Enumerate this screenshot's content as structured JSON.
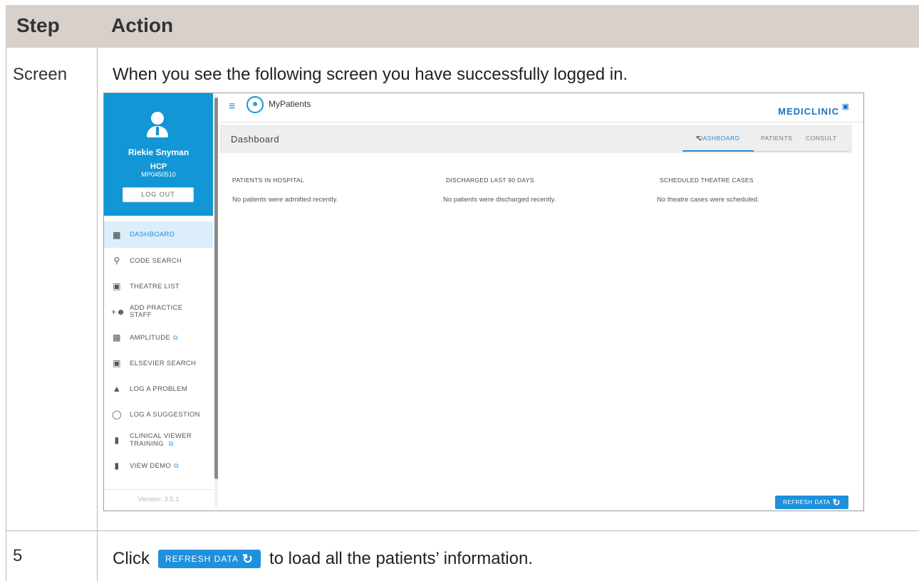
{
  "table": {
    "header_step": "Step",
    "header_action": "Action",
    "row1_step": "Screen",
    "row1_text": "When you see the following screen you have successfully logged in.",
    "row2_step": "5",
    "row2_click": "Click",
    "row2_button": "REFRESH DATA",
    "row2_rest": "to load all the patients’ information."
  },
  "app": {
    "name": "MyPatients",
    "brand": "MEDICLINIC",
    "profile": {
      "name": "Riekie Snyman",
      "role": "HCP",
      "number": "MP0450510",
      "logout": "LOG OUT"
    },
    "nav": [
      {
        "label": "DASHBOARD",
        "icon": "dashboard-icon",
        "active": true
      },
      {
        "label": "CODE SEARCH",
        "icon": "search-icon"
      },
      {
        "label": "THEATRE LIST",
        "icon": "calendar-icon"
      },
      {
        "label": "ADD PRACTICE STAFF",
        "line1": "ADD PRACTICE",
        "line2": "STAFF",
        "icon": "add-group-icon"
      },
      {
        "label": "AMPLITUDE",
        "icon": "briefcase-icon",
        "external": true
      },
      {
        "label": "ELSEVIER SEARCH",
        "icon": "search-box-icon"
      },
      {
        "label": "LOG A PROBLEM",
        "icon": "warning-icon"
      },
      {
        "label": "LOG A SUGGESTION",
        "icon": "lightbulb-icon"
      },
      {
        "label": "CLINICAL VIEWER TRAINING",
        "line1": "CLINICAL VIEWER",
        "line2": "TRAINING",
        "icon": "video-icon",
        "external": true
      },
      {
        "label": "VIEW DEMO",
        "icon": "video-icon",
        "external": true
      }
    ],
    "version": "Version: 3.5.1",
    "page_title": "Dashboard",
    "tabs": [
      "DASHBOARD",
      "PATIENTS",
      "CONSULT"
    ],
    "columns": [
      {
        "heading": "PATIENTS IN HOSPITAL",
        "value": "No patients were admitted recently."
      },
      {
        "heading": "DISCHARGED LAST 90 DAYS",
        "value": "No patients were discharged recently."
      },
      {
        "heading": "SCHEDULED THEATRE CASES",
        "value": "No theatre cases were scheduled."
      }
    ],
    "refresh_button": "REFRESH DATA"
  }
}
